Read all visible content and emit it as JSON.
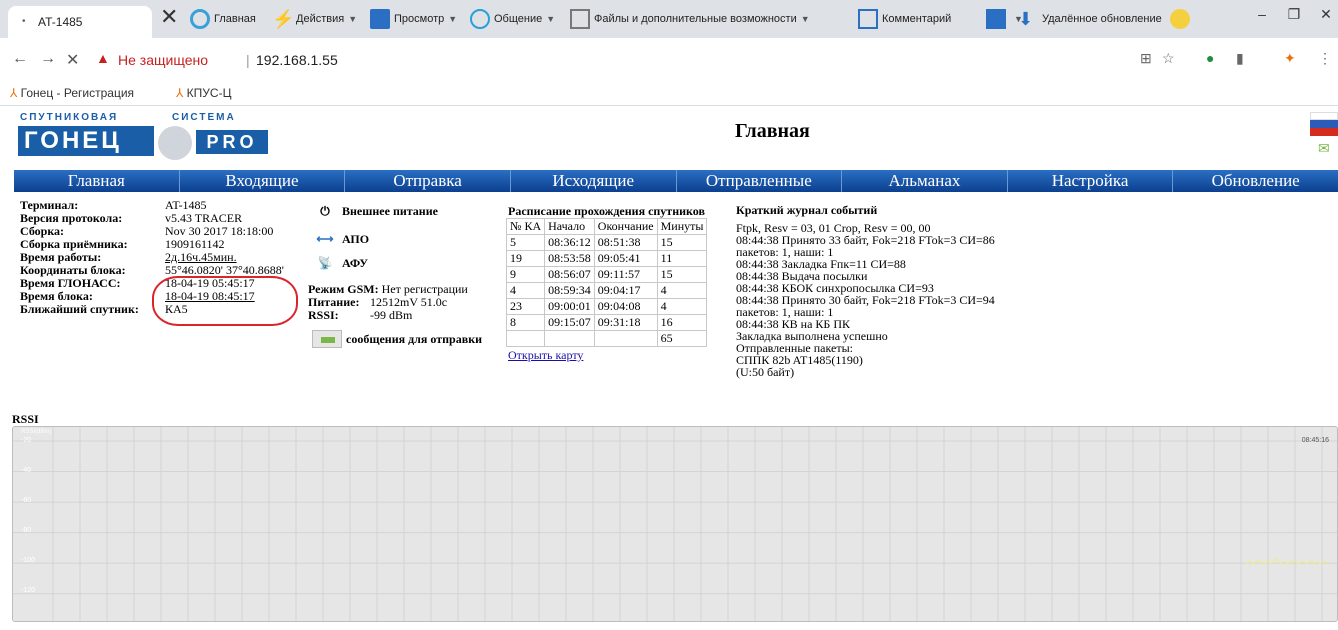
{
  "browser": {
    "tab_title": "AT-1485",
    "extensions": [
      {
        "label": "Главная",
        "color": "#3aa0d8"
      },
      {
        "label": "Действия",
        "color": "#f4b400"
      },
      {
        "label": "Просмотр",
        "color": "#2a6fc4"
      },
      {
        "label": "Общение",
        "color": "#2a9fd8"
      },
      {
        "label": "Файлы и дополнительные возможности",
        "color": "#4caf50"
      },
      {
        "label": "Комментарий",
        "color": "#2a6fc4"
      },
      {
        "label": "",
        "color": "#2a6fc4"
      },
      {
        "label": "Удалённое обновление",
        "color": "#2a6fc4"
      }
    ],
    "security_text": "Не защищено",
    "url": "192.168.1.55",
    "bookmarks": [
      "Гонец - Регистрация",
      "КПУС-Ц"
    ]
  },
  "logo": {
    "top_left": "СПУТНИКОВАЯ",
    "top_right": "СИСТЕМА",
    "brand": "ГОНЕЦ",
    "pro": "PRO"
  },
  "page_title": "Главная",
  "menu": [
    "Главная",
    "Входящие",
    "Отправка",
    "Исходящие",
    "Отправленные",
    "Альманах",
    "Настройка",
    "Обновление"
  ],
  "info": [
    {
      "label": "Терминал:",
      "value": "AT-1485"
    },
    {
      "label": "Версия протокола:",
      "value": "v5.43 TRACER"
    },
    {
      "label": "Сборка:",
      "value": "Nov 30 2017 18:18:00"
    },
    {
      "label": "Сборка приёмника:",
      "value": "1909161142"
    },
    {
      "label": "Время работы:",
      "value": "2д.16ч.45мин."
    },
    {
      "label": "Координаты блока:",
      "value": "55°46.0820' 37°40.8688'"
    },
    {
      "label": "Время ГЛОНАСС:",
      "value": "18-04-19 05:45:17"
    },
    {
      "label": "Время блока:",
      "value": "18-04-19 08:45:17"
    },
    {
      "label": "Ближайший спутник:",
      "value": "КА5"
    }
  ],
  "status": {
    "power": "Внешнее питание",
    "apo": "АПО",
    "afu": "АФУ",
    "gsm_label": "Режим GSM:",
    "gsm_value": "Нет регистрации",
    "power_label": "Питание:",
    "power_value": "12512mV 51.0c",
    "rssi_label": "RSSI:",
    "rssi_value": "-99 dBm",
    "messages": "сообщения для отправки"
  },
  "schedule": {
    "title": "Расписание прохождения спутников",
    "headers": [
      "№ КА",
      "Начало",
      "Окончание",
      "Минуты"
    ],
    "rows": [
      [
        "5",
        "08:36:12",
        "08:51:38",
        "15"
      ],
      [
        "19",
        "08:53:58",
        "09:05:41",
        "11"
      ],
      [
        "9",
        "08:56:07",
        "09:11:57",
        "15"
      ],
      [
        "4",
        "08:59:34",
        "09:04:17",
        "4"
      ],
      [
        "23",
        "09:00:01",
        "09:04:08",
        "4"
      ],
      [
        "8",
        "09:15:07",
        "09:31:18",
        "16"
      ],
      [
        "",
        "",
        "",
        "65"
      ]
    ],
    "map_link": "Открыть карту"
  },
  "log": {
    "title": "Краткий журнал событий",
    "lines": [
      "Ftpk, Resv = 03, 01 Crop, Resv = 00, 00",
      "08:44:38 Принято 33 байт, Fok=218 FTok=3 СИ=86",
      "пакетов: 1, наши: 1",
      "08:44:38 Закладка Fпк=11 СИ=88",
      "08:44:38 Выдача посылки",
      "08:44:38 КБОК синхропосылка СИ=93",
      "08:44:38 Принято 30 байт, Fok=218 FTok=3 СИ=94",
      "пакетов: 1, наши: 1",
      "08:44:38 КВ на КБ ПК",
      "Закладка выполнена успешно",
      "Отправленные пакеты:",
      "СППК 82b AT1485(1190)",
      "(U:50 байт)"
    ]
  },
  "rssi_chart": {
    "label": "RSSI",
    "unit": "RSSI(dBm)",
    "yticks": [
      "-20",
      "-40",
      "-60",
      "-80",
      "-100",
      "-120"
    ],
    "time_label": "08:45:16"
  },
  "chart_data": {
    "type": "line",
    "title": "RSSI",
    "ylabel": "RSSI(dBm)",
    "ylim": [
      -130,
      -20
    ],
    "yticks": [
      -20,
      -40,
      -60,
      -80,
      -100,
      -120
    ],
    "x": [
      "08:45:16"
    ],
    "series": [
      {
        "values": [
          -101,
          -99,
          -100,
          -98,
          -101,
          -99,
          -100,
          -97,
          -100,
          -99,
          -101,
          -98,
          -100,
          -99,
          -100,
          -98,
          -101,
          -100,
          -99,
          -100
        ]
      }
    ],
    "grid": true,
    "color": "#f2ec82"
  }
}
